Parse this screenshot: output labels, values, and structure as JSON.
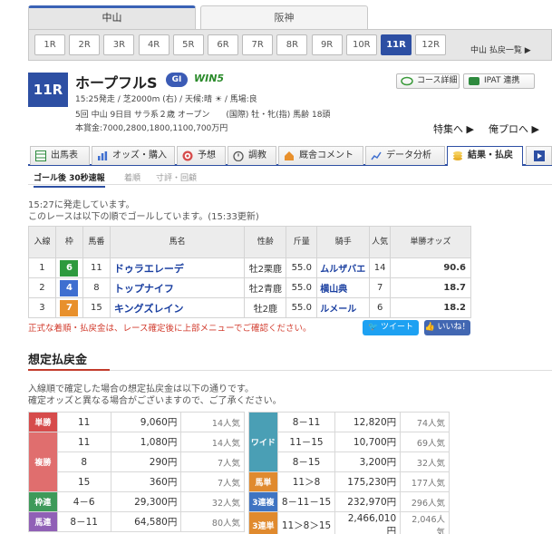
{
  "venues": [
    {
      "label": "中山",
      "active": true
    },
    {
      "label": "阪神",
      "active": false
    }
  ],
  "races": [
    "1R",
    "2R",
    "3R",
    "4R",
    "5R",
    "6R",
    "7R",
    "8R",
    "9R",
    "10R",
    "11R",
    "12R"
  ],
  "active_race": "11R",
  "race_list_link": "中山 払戻一覧 ▶",
  "race": {
    "number": "11R",
    "name": "ホープフルS",
    "grade": "GI",
    "win5": "WIN5",
    "line1": "15:25発走 / 芝2000m (右) / 天候:晴 ☀ / 馬場:良",
    "line2": "5回 中山 9日目 サラ系２歳 オープン　　(国際) 牡・牝(指) 馬齢 18頭",
    "line3": "本賞金:7000,2800,1800,1100,700万円"
  },
  "header_buttons": {
    "course": "コース詳細",
    "ipat": "IPAT 連携",
    "tokusyu": "特集へ ▶",
    "orepro": "俺プロへ ▶"
  },
  "main_tabs": [
    {
      "label": "出馬表",
      "icon": "table-icon"
    },
    {
      "label": "オッズ・購入",
      "icon": "odds-icon"
    },
    {
      "label": "予想",
      "icon": "target-icon"
    },
    {
      "label": "調教",
      "icon": "stopwatch-icon"
    },
    {
      "label": "厩舎コメント",
      "icon": "stable-icon"
    },
    {
      "label": "データ分析",
      "icon": "chart-icon"
    },
    {
      "label": "結果・払戻",
      "icon": "coin-icon"
    }
  ],
  "sub_tabs": [
    "ゴール後 30秒速報",
    "着順",
    "寸評・回顧"
  ],
  "status": {
    "line1": "15:27に発走しています。",
    "line2": "このレースは以下の順でゴールしています。(15:33更新)"
  },
  "result_headers": [
    "入線",
    "枠",
    "馬番",
    "馬名",
    "性齢",
    "斤量",
    "騎手",
    "人気",
    "単勝オッズ"
  ],
  "results": [
    {
      "rank": "1",
      "waku": "6",
      "waku_color": "#2e9a3e",
      "num": "11",
      "name": "ドゥラエレーデ",
      "sex_age": "牡2栗鹿",
      "weight": "55.0",
      "jockey": "ムルザバエ",
      "pop": "14",
      "odds": "90.6"
    },
    {
      "rank": "2",
      "waku": "4",
      "waku_color": "#3f6fd0",
      "num": "8",
      "name": "トップナイフ",
      "sex_age": "牡2青鹿",
      "weight": "55.0",
      "jockey": "横山典",
      "pop": "7",
      "odds": "18.7"
    },
    {
      "rank": "3",
      "waku": "7",
      "waku_color": "#e8902c",
      "num": "15",
      "name": "キングズレイン",
      "sex_age": "牡2鹿",
      "weight": "55.0",
      "jockey": "ルメール",
      "pop": "6",
      "odds": "18.2"
    }
  ],
  "warning": "正式な着順・払戻金は、レース確定後に上部メニューでご確認ください。",
  "social": {
    "tweet": "ツイート",
    "like": "いいね！"
  },
  "payout_title": "想定払戻金",
  "payout_note": {
    "line1": "入線順で確定した場合の想定払戻金は以下の通りです。",
    "line2": "確定オッズと異なる場合がございますので、ご了承ください。"
  },
  "payout_left": [
    {
      "label": "単勝",
      "cls": "c-tan",
      "rows": [
        {
          "comb": "11",
          "amount": "9,060円",
          "pop": "14人気"
        }
      ]
    },
    {
      "label": "複勝",
      "cls": "c-fuku",
      "rows": [
        {
          "comb": "11",
          "amount": "1,080円",
          "pop": "14人気"
        },
        {
          "comb": "8",
          "amount": "290円",
          "pop": "7人気"
        },
        {
          "comb": "15",
          "amount": "360円",
          "pop": "7人気"
        }
      ]
    },
    {
      "label": "枠連",
      "cls": "c-waku",
      "rows": [
        {
          "comb": "4－6",
          "amount": "29,300円",
          "pop": "32人気"
        }
      ]
    },
    {
      "label": "馬連",
      "cls": "c-umaren",
      "rows": [
        {
          "comb": "8－11",
          "amount": "64,580円",
          "pop": "80人気"
        }
      ]
    }
  ],
  "payout_right": [
    {
      "label": "ワイド",
      "cls": "c-wide",
      "rows": [
        {
          "comb": "8－11",
          "amount": "12,820円",
          "pop": "74人気"
        },
        {
          "comb": "11－15",
          "amount": "10,700円",
          "pop": "69人気"
        },
        {
          "comb": "8－15",
          "amount": "3,200円",
          "pop": "32人気"
        }
      ]
    },
    {
      "label": "馬単",
      "cls": "c-umatan",
      "rows": [
        {
          "comb": "11＞8",
          "amount": "175,230円",
          "pop": "177人気"
        }
      ]
    },
    {
      "label": "3連複",
      "cls": "c-sanpuku",
      "rows": [
        {
          "comb": "8－11－15",
          "amount": "232,970円",
          "pop": "296人気"
        }
      ]
    },
    {
      "label": "3連単",
      "cls": "c-santan",
      "rows": [
        {
          "comb": "11＞8＞15",
          "amount": "2,466,010円",
          "pop": "2,046人気"
        }
      ]
    }
  ]
}
